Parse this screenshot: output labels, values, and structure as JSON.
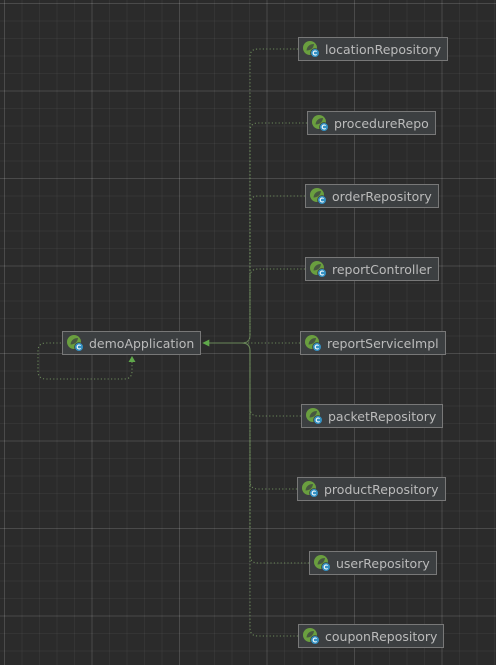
{
  "diagram": {
    "root": {
      "id": "demoApplication",
      "label": "demoApplication",
      "icon": "spring-bean-icon"
    },
    "beans": [
      {
        "id": "locationRepository",
        "label": "locationRepository",
        "icon": "spring-bean-icon"
      },
      {
        "id": "procedureRepo",
        "label": "procedureRepo",
        "icon": "spring-bean-icon"
      },
      {
        "id": "orderRepository",
        "label": "orderRepository",
        "icon": "spring-bean-icon"
      },
      {
        "id": "reportController",
        "label": "reportController",
        "icon": "spring-bean-icon"
      },
      {
        "id": "reportServiceImpl",
        "label": "reportServiceImpl",
        "icon": "spring-bean-icon"
      },
      {
        "id": "packetRepository",
        "label": "packetRepository",
        "icon": "spring-bean-icon"
      },
      {
        "id": "productRepository",
        "label": "productRepository",
        "icon": "spring-bean-icon"
      },
      {
        "id": "userRepository",
        "label": "userRepository",
        "icon": "spring-bean-icon"
      },
      {
        "id": "couponRepository",
        "label": "couponRepository",
        "icon": "spring-bean-icon"
      }
    ],
    "colors": {
      "background": "#2b2b2b",
      "node_fill": "#3c3f41",
      "node_border": "#787878",
      "label": "#bbbbbb",
      "edge": "#6a8759",
      "arrowhead": "#5fa84a",
      "icon_green": "#6a9f3f",
      "icon_badge": "#3592c4"
    }
  }
}
